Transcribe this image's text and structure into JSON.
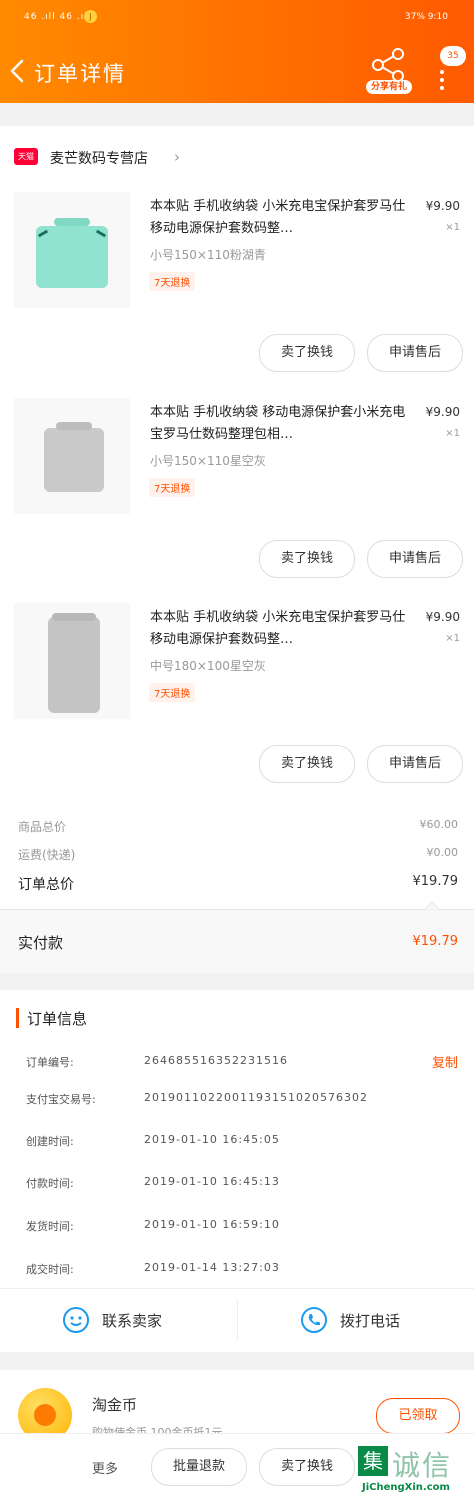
{
  "status_bar": {
    "left": "46 .ıll 46 .ıll",
    "jd": "J",
    "right": "37%  9:10"
  },
  "header": {
    "title": "订单详情",
    "share_label": "分享有礼",
    "badge": "35"
  },
  "shop": {
    "tag": "天猫",
    "name": "麦芒数码专营店"
  },
  "items": [
    {
      "title": "本本贴 手机收纳袋 小米充电宝保护套罗马仕移动电源保护套数码整…",
      "sku": "小号150×110粉湖青",
      "tag": "7天退换",
      "price": "¥9.90",
      "qty": "×1",
      "btn1": "卖了换钱",
      "btn2": "申请售后"
    },
    {
      "title": "本本贴 手机收纳袋 移动电源保护套小米充电宝罗马仕数码整理包相…",
      "sku": "小号150×110星空灰",
      "tag": "7天退换",
      "price": "¥9.90",
      "qty": "×1",
      "btn1": "卖了换钱",
      "btn2": "申请售后"
    },
    {
      "title": "本本贴 手机收纳袋 小米充电宝保护套罗马仕移动电源保护套数码整…",
      "sku": "中号180×100星空灰",
      "tag": "7天退换",
      "price": "¥9.90",
      "qty": "×1",
      "btn1": "卖了换钱",
      "btn2": "申请售后"
    }
  ],
  "summary": {
    "goods_label": "商品总价",
    "goods_value": "¥60.00",
    "ship_label": "运费(快递)",
    "ship_value": "¥0.00",
    "total_label": "订单总价",
    "total_value": "¥19.79",
    "paid_label": "实付款",
    "paid_value": "¥19.79"
  },
  "order_info": {
    "heading": "订单信息",
    "copy_label": "复制",
    "rows": [
      {
        "k": "订单编号:",
        "v": "264685516352231516"
      },
      {
        "k": "支付宝交易号:",
        "v": "2019011022001193151020576302"
      },
      {
        "k": "创建时间:",
        "v": "2019-01-10 16:45:05"
      },
      {
        "k": "付款时间:",
        "v": "2019-01-10 16:45:13"
      },
      {
        "k": "发货时间:",
        "v": "2019-01-10 16:59:10"
      },
      {
        "k": "成交时间:",
        "v": "2019-01-14 13:27:03"
      }
    ]
  },
  "contact": {
    "seller": "联系卖家",
    "phone": "拨打电话"
  },
  "coin": {
    "title": "淘金币",
    "sub": "购物使金币 100金币抵1元",
    "claimed": "已领取"
  },
  "bottom": {
    "more": "更多",
    "batch": "批量退款",
    "sell": "卖了换钱"
  },
  "watermark": {
    "char": "集",
    "big": "诚信",
    "url": "JiChengXin.com"
  },
  "colors": {
    "accent": "#ff5000",
    "header_from": "#ff8a00",
    "header_to": "#ff5a00"
  }
}
